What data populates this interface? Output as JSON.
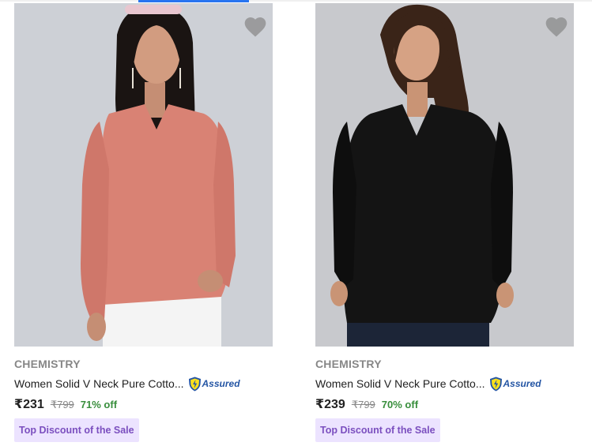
{
  "products": [
    {
      "brand": "CHEMISTRY",
      "title": "Women Solid V Neck Pure Cotto...",
      "assured_label": "Assured",
      "price": "₹231",
      "mrp": "₹799",
      "discount": "71% off",
      "tag": "Top Discount of the Sale",
      "shirt_color": "#d98274"
    },
    {
      "brand": "CHEMISTRY",
      "title": "Women Solid V Neck Pure Cotto...",
      "assured_label": "Assured",
      "price": "₹239",
      "mrp": "₹799",
      "discount": "70% off",
      "tag": "Top Discount of the Sale",
      "shirt_color": "#141414"
    }
  ],
  "colors": {
    "accent": "#2874f0",
    "discount": "#388e3c",
    "tag_background": "#ece3ff",
    "tag_text": "#7b4fbf",
    "assured": "#2455a4"
  }
}
